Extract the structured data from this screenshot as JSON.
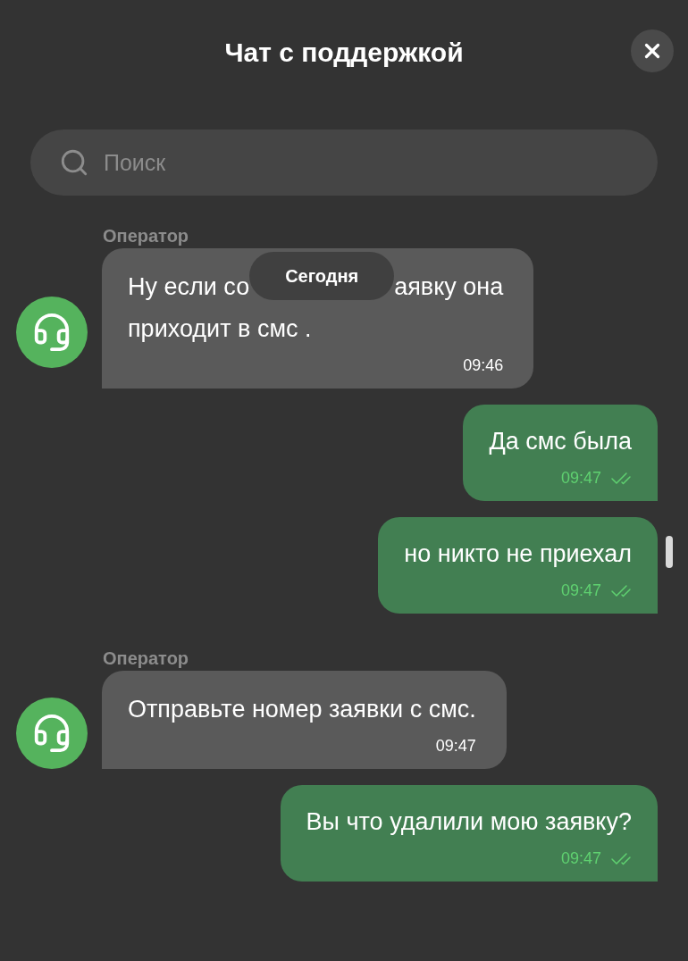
{
  "header": {
    "title": "Чат с поддержкой"
  },
  "search": {
    "placeholder": "Поиск"
  },
  "date_divider": "Сегодня",
  "messages": [
    {
      "kind": "operator",
      "sender": "Оператор",
      "lines": [
        {
          "parts": [
            "Ну если со",
            "аявку она"
          ]
        },
        {
          "parts": [
            "приходит в смс ."
          ]
        }
      ],
      "time": "09:46"
    },
    {
      "kind": "user",
      "lines": [
        {
          "parts": [
            "Да смс была"
          ]
        }
      ],
      "time": "09:47",
      "read": true
    },
    {
      "kind": "user",
      "lines": [
        {
          "parts": [
            "но никто не приехал"
          ]
        }
      ],
      "time": "09:47",
      "read": true
    },
    {
      "kind": "operator",
      "sender": "Оператор",
      "lines": [
        {
          "parts": [
            "Отправьте номер заявки с смс."
          ]
        }
      ],
      "time": "09:47"
    },
    {
      "kind": "user",
      "lines": [
        {
          "parts": [
            "Вы что удалили мою заявку?"
          ]
        }
      ],
      "time": "09:47",
      "read": true
    }
  ]
}
